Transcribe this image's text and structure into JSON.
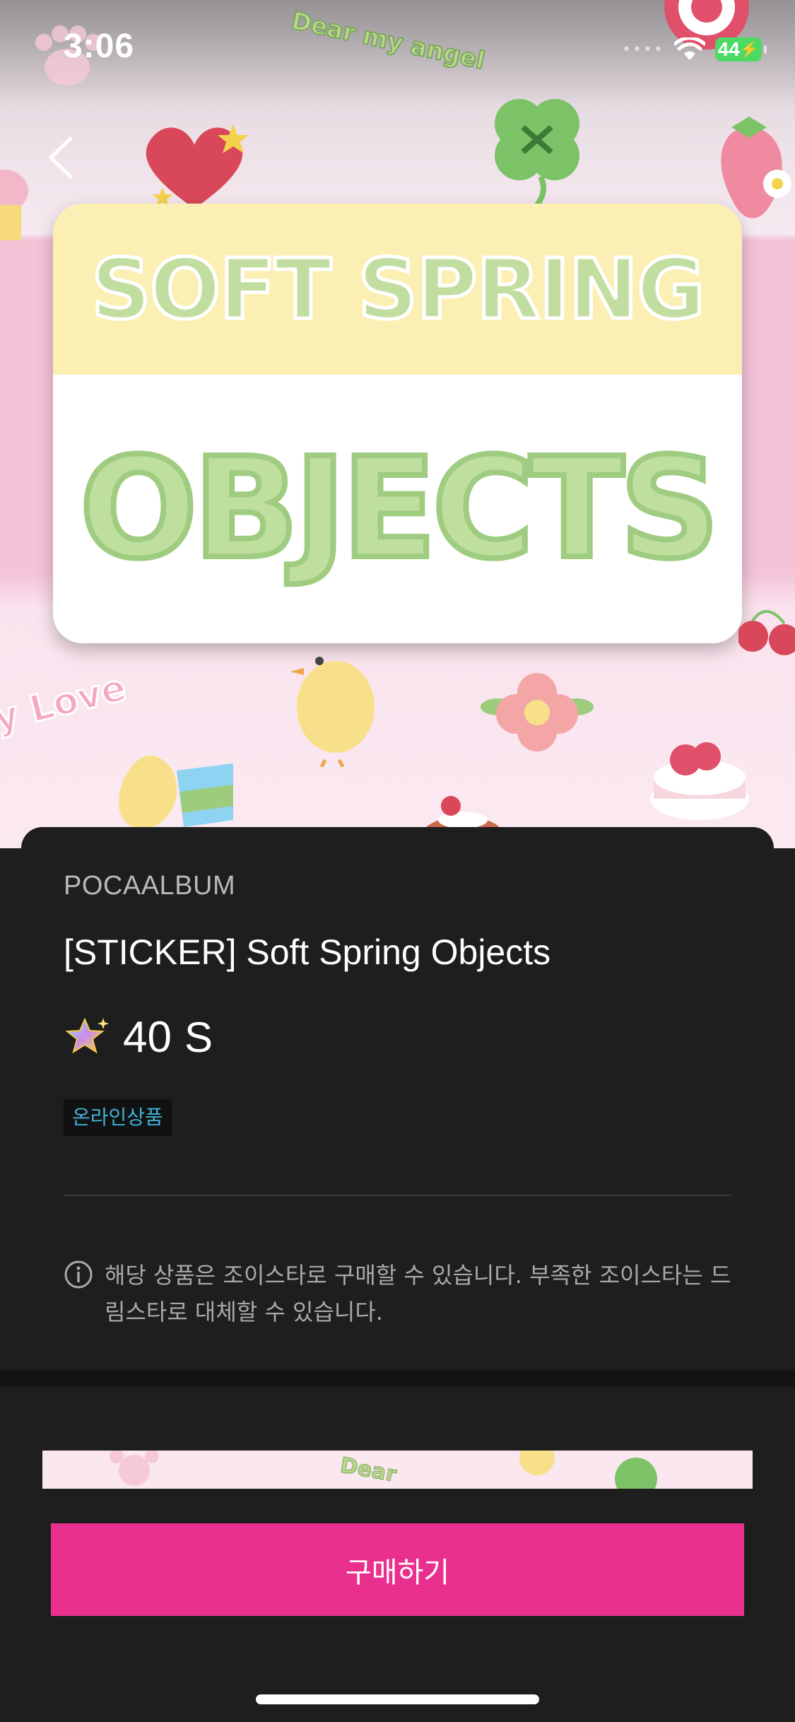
{
  "status_bar": {
    "time": "3:06",
    "battery": "44",
    "icons": [
      "signal-dots-icon",
      "wifi-icon",
      "battery-charging-icon"
    ]
  },
  "nav": {
    "back_icon": "chevron-left-icon"
  },
  "hero": {
    "title_line1": "SOFT SPRING",
    "title_line2": "OBJECTS",
    "sticker_text_dear": "Dear my angel",
    "sticker_text_love": "y Love",
    "colors": {
      "top_band": "#fbefb4",
      "letters": "#bfdf9f",
      "pink_band": "#f4c3d8"
    }
  },
  "product": {
    "brand": "POCAALBUM",
    "title": "[STICKER] Soft Spring Objects",
    "price_amount": "40",
    "price_unit": "S",
    "price_icon": "joystar-icon",
    "badge": "온라인상품",
    "notice_icon": "info-circle-icon",
    "notice": "해당 상품은 조이스타로 구매할 수 있습니다. 부족한 조이스타는 드림스타로 대체할 수 있습니다."
  },
  "actions": {
    "buy_label": "구매하기",
    "buy_color": "#e9308f"
  }
}
